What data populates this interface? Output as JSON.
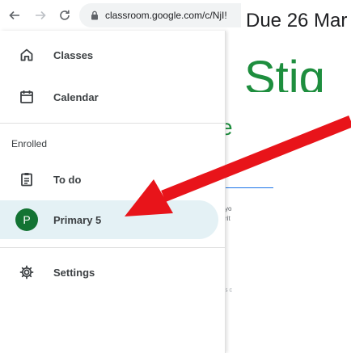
{
  "browser": {
    "url": "classroom.google.com/c/NjI!",
    "icons": [
      "back-arrow-icon",
      "forward-arrow-icon",
      "reload-icon",
      "lock-icon"
    ]
  },
  "background_page": {
    "due_text": "Due 26 Mar",
    "title_text": "Stig",
    "fragment_letter": "e",
    "snippet_1": "yo",
    "snippet_2": "rit",
    "snippet_3": "s c"
  },
  "drawer": {
    "items": [
      {
        "label": "Classes",
        "icon": "home-icon"
      },
      {
        "label": "Calendar",
        "icon": "calendar-icon"
      }
    ],
    "section_label": "Enrolled",
    "enrolled": [
      {
        "label": "To do",
        "icon": "todo-clipboard-icon"
      },
      {
        "label": "Primary 5",
        "avatar_letter": "P",
        "selected": true
      }
    ],
    "settings_label": "Settings"
  },
  "colors": {
    "selected_bg": "#e4f1f5",
    "avatar": "#137333",
    "title_green": "#1e8e3e",
    "annotation_red": "#e8141a"
  }
}
